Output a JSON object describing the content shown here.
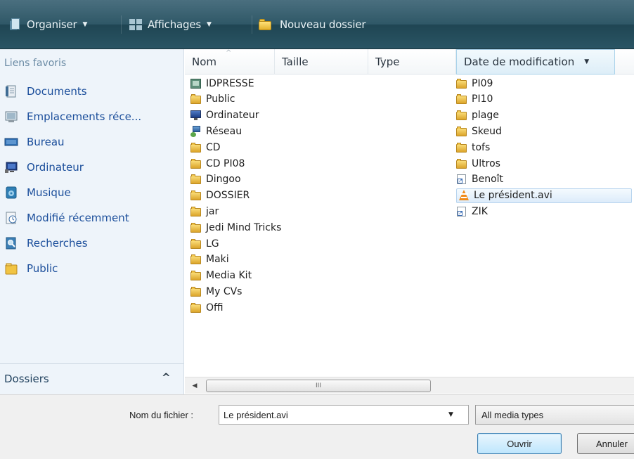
{
  "toolbar": {
    "organize_label": "Organiser",
    "views_label": "Affichages",
    "new_folder_label": "Nouveau dossier"
  },
  "sidebar": {
    "title": "Liens favoris",
    "items": [
      {
        "label": "Documents",
        "icon": "documents-icon"
      },
      {
        "label": "Emplacements réce...",
        "icon": "recent-places-icon"
      },
      {
        "label": "Bureau",
        "icon": "desktop-icon"
      },
      {
        "label": "Ordinateur",
        "icon": "computer-icon"
      },
      {
        "label": "Musique",
        "icon": "music-icon"
      },
      {
        "label": "Modifié récemment",
        "icon": "recently-changed-icon"
      },
      {
        "label": "Recherches",
        "icon": "searches-icon"
      },
      {
        "label": "Public",
        "icon": "folder-icon"
      }
    ],
    "folders_label": "Dossiers",
    "folders_chevron": "^"
  },
  "columns": {
    "name": "Nom",
    "size": "Taille",
    "type": "Type",
    "date": "Date de modification"
  },
  "files": {
    "col1": [
      {
        "name": "IDPRESSE",
        "kind": "idpresse"
      },
      {
        "name": "Public",
        "kind": "folder"
      },
      {
        "name": "Ordinateur",
        "kind": "monitor"
      },
      {
        "name": "Réseau",
        "kind": "network"
      },
      {
        "name": "CD",
        "kind": "folder"
      },
      {
        "name": "CD PI08",
        "kind": "folder"
      },
      {
        "name": "Dingoo",
        "kind": "folder"
      },
      {
        "name": "DOSSIER",
        "kind": "folder"
      },
      {
        "name": "jar",
        "kind": "folder"
      },
      {
        "name": "Jedi Mind Tricks",
        "kind": "folder"
      },
      {
        "name": "LG",
        "kind": "folder"
      },
      {
        "name": "Maki",
        "kind": "folder"
      },
      {
        "name": "Media Kit",
        "kind": "folder"
      },
      {
        "name": "My CVs",
        "kind": "folder"
      },
      {
        "name": "Offi",
        "kind": "folder"
      }
    ],
    "col2": [
      {
        "name": "PI09",
        "kind": "folder"
      },
      {
        "name": "PI10",
        "kind": "folder"
      },
      {
        "name": "plage",
        "kind": "folder"
      },
      {
        "name": "Skeud",
        "kind": "folder"
      },
      {
        "name": "tofs",
        "kind": "folder"
      },
      {
        "name": "Ultros",
        "kind": "folder"
      },
      {
        "name": "Benoît",
        "kind": "shortcut"
      },
      {
        "name": "Le président.avi",
        "kind": "vlc",
        "selected": true
      },
      {
        "name": "ZIK",
        "kind": "shortcut"
      }
    ]
  },
  "scrollbar": {
    "thumb_grip": "III"
  },
  "bottom": {
    "filename_label": "Nom du fichier :",
    "filename_value": "Le président.avi",
    "types_value": "All media types",
    "open_label": "Ouvrir",
    "cancel_label": "Annuler"
  },
  "colors": {
    "toolbar": "#2f5867",
    "sidebar_bg": "#eef4fa",
    "link": "#1b4e9b",
    "selection": "#dcebfa"
  }
}
